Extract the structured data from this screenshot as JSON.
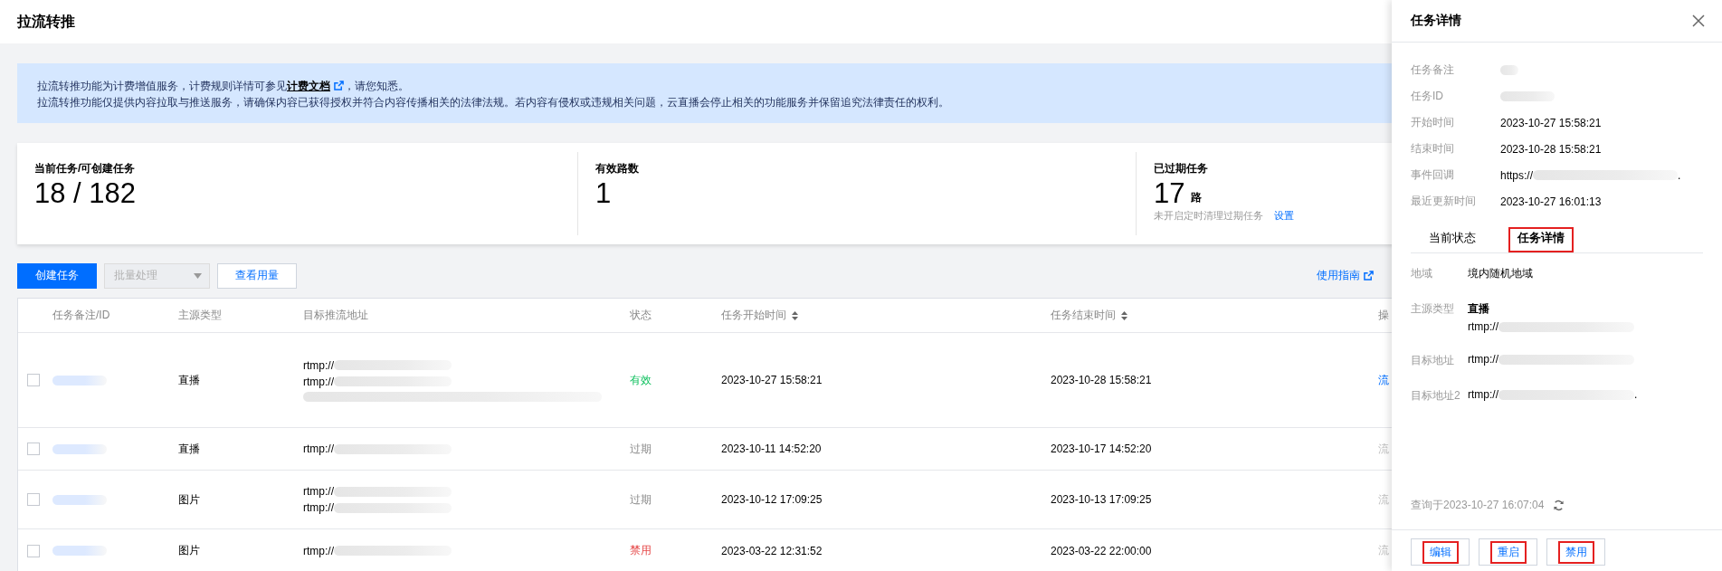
{
  "page_title": "拉流转推",
  "notice": {
    "lines": [
      {
        "before": "拉流转推功能为计费增值服务，计费规则详情可参见",
        "link": "计费文档",
        "after": "，请您知悉。"
      },
      {
        "before": "拉流转推功能仅提供内容拉取与推送服务，请确保内容已获得授权并符合内容传播相关的法律法规。若内容有侵权或违规相关问题，云直播会停止相关的功能服务并保留追究法律责任的权利。"
      }
    ]
  },
  "stats": [
    {
      "label": "当前任务/可创建任务",
      "value": "18 / 182"
    },
    {
      "label": "有效路数",
      "value": "1"
    },
    {
      "label": "已过期任务",
      "value": "17",
      "unit": "路",
      "note": "未开启定时清理过期任务",
      "note_link": "设置"
    }
  ],
  "toolbar": {
    "create": "创建任务",
    "batch": {
      "label": "批量处理",
      "disabled": true
    },
    "usage": "查看用量",
    "guide": "使用指南"
  },
  "table": {
    "columns": [
      {
        "label": "任务备注/ID",
        "sortable": false
      },
      {
        "label": "主源类型",
        "sortable": false
      },
      {
        "label": "目标推流地址",
        "sortable": false
      },
      {
        "label": "状态",
        "sortable": false
      },
      {
        "label": "任务开始时间",
        "sortable": true
      },
      {
        "label": "任务结束时间",
        "sortable": true
      },
      {
        "label": "操"
      }
    ],
    "rows": [
      {
        "checked": false,
        "source": "直播",
        "targets": [
          [
            {
              "kind": "text",
              "text": "rtmp://"
            },
            {
              "kind": "blur"
            }
          ],
          [
            {
              "kind": "text",
              "text": "rtmp://"
            },
            {
              "kind": "blur"
            }
          ],
          [
            {
              "kind": "blur"
            }
          ]
        ],
        "status": {
          "text": "有效",
          "color": "#0abf5b"
        },
        "start": "2023-10-27 15:58:21",
        "end": "2023-10-28 15:58:21",
        "action": {
          "text": "流",
          "disabled": false
        }
      },
      {
        "checked": false,
        "source": "直播",
        "targets": [
          [
            {
              "kind": "text",
              "text": "rtmp://"
            },
            {
              "kind": "blur"
            }
          ]
        ],
        "status": {
          "text": "过期",
          "color": "#888888"
        },
        "start": "2023-10-11 14:52:20",
        "end": "2023-10-17 14:52:20",
        "action": {
          "text": "流",
          "disabled": true
        }
      },
      {
        "checked": false,
        "source": "图片",
        "targets": [
          [
            {
              "kind": "text",
              "text": "rtmp://"
            },
            {
              "kind": "blur"
            }
          ],
          [
            {
              "kind": "text",
              "text": "rtmp://"
            },
            {
              "kind": "blur"
            }
          ]
        ],
        "status": {
          "text": "过期",
          "color": "#888888"
        },
        "start": "2023-10-12 17:09:25",
        "end": "2023-10-13 17:09:25",
        "action": {
          "text": "流",
          "disabled": true
        }
      },
      {
        "checked": false,
        "source": "图片",
        "targets": [
          [
            {
              "kind": "text",
              "text": "rtmp://"
            },
            {
              "kind": "blur"
            }
          ]
        ],
        "status": {
          "text": "禁用",
          "color": "#e54545"
        },
        "start": "2023-03-22 12:31:52",
        "end": "2023-03-22 22:00:00",
        "action": {
          "text": "流",
          "disabled": true
        }
      }
    ]
  },
  "drawer": {
    "title": "任务详情",
    "info": [
      {
        "label": "任务备注",
        "value": [
          {
            "kind": "blur"
          }
        ]
      },
      {
        "label": "任务ID",
        "value": [
          {
            "kind": "blur"
          }
        ]
      },
      {
        "label": "开始时间",
        "value": [
          {
            "kind": "text",
            "text": "2023-10-27 15:58:21"
          }
        ]
      },
      {
        "label": "结束时间",
        "value": [
          {
            "kind": "text",
            "text": "2023-10-28 15:58:21"
          }
        ]
      },
      {
        "label": "事件回调",
        "value": [
          {
            "kind": "text",
            "text": "https://"
          },
          {
            "kind": "blur"
          },
          {
            "kind": "text",
            "text": "."
          }
        ]
      },
      {
        "label": "最近更新时间",
        "value": [
          {
            "kind": "text",
            "text": "2023-10-27 16:01:13"
          }
        ]
      }
    ],
    "tabs": [
      {
        "label": "当前状态",
        "selected": false,
        "highlighted": false
      },
      {
        "label": "任务详情",
        "selected": true,
        "highlighted": true
      }
    ],
    "details": [
      {
        "label": "地域",
        "lines": [
          [
            {
              "kind": "text",
              "text": "境内随机地域"
            }
          ]
        ]
      },
      {
        "label": "主源类型",
        "lines": [
          [
            {
              "kind": "strong",
              "text": "直播"
            }
          ],
          [
            {
              "kind": "text",
              "text": "rtmp://"
            },
            {
              "kind": "blur"
            }
          ]
        ]
      },
      {
        "label": "目标地址",
        "lines": [
          [
            {
              "kind": "text",
              "text": "rtmp://"
            },
            {
              "kind": "blur"
            }
          ]
        ]
      },
      {
        "label": "目标地址2",
        "lines": [
          [
            {
              "kind": "text",
              "text": "rtmp://"
            },
            {
              "kind": "blur"
            },
            {
              "kind": "text",
              "text": "."
            }
          ]
        ]
      }
    ],
    "query_time": "查询于2023-10-27 16:07:04",
    "buttons": [
      {
        "label": "编辑",
        "highlighted": true
      },
      {
        "label": "重启",
        "highlighted": true
      },
      {
        "label": "禁用",
        "highlighted": true
      }
    ]
  }
}
